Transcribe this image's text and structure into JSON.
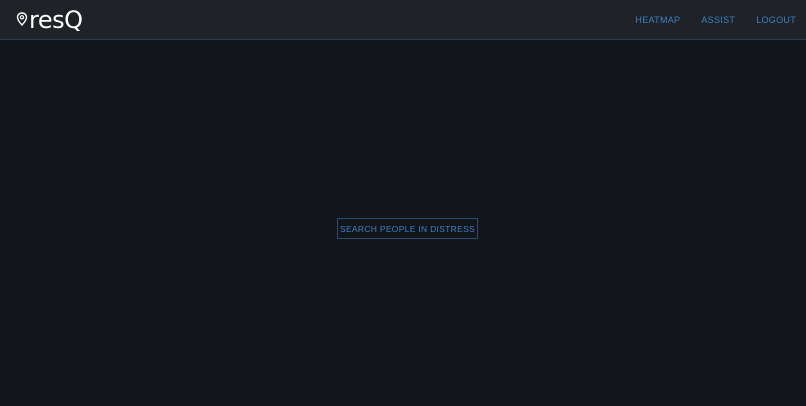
{
  "brand": {
    "name": "resQ",
    "icon": "map-pin-icon"
  },
  "nav": {
    "items": [
      {
        "label": "HEATMAP"
      },
      {
        "label": "ASSIST"
      },
      {
        "label": "LOGOUT"
      }
    ]
  },
  "main": {
    "search_button_label": "SEARCH PEOPLE IN DISTRESS"
  },
  "colors": {
    "background": "#121519",
    "navbar": "#1f2226",
    "accent": "#3b82c4",
    "button_border": "#2c4a72"
  }
}
